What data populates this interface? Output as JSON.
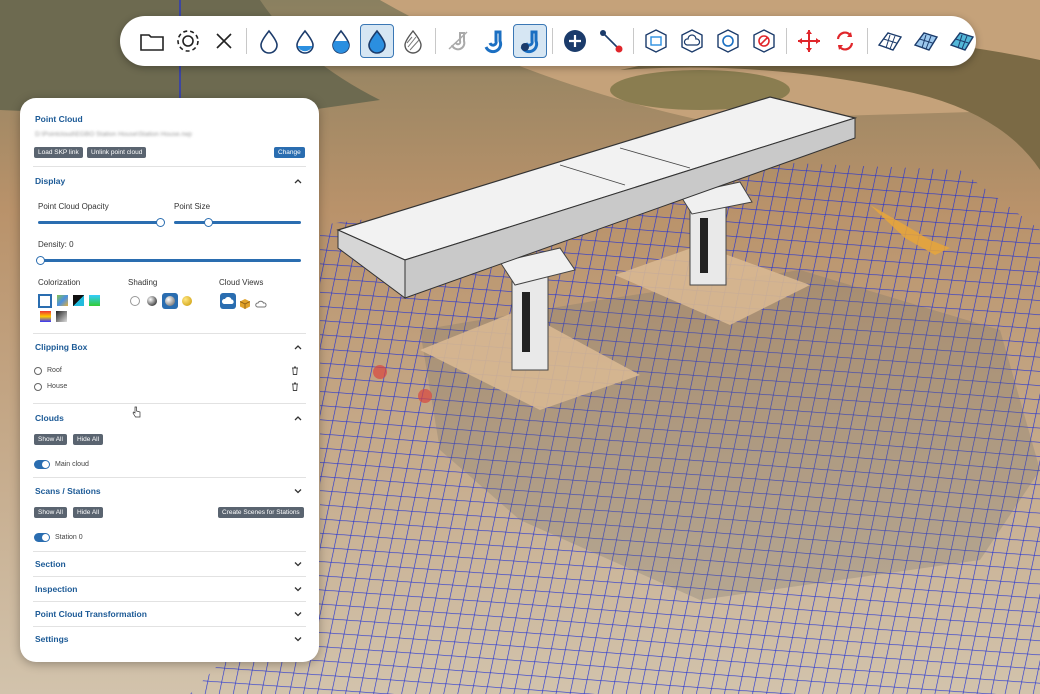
{
  "toolbar": {
    "icons": [
      "folder-icon",
      "gear-icon",
      "close-icon",
      "drop-outline-icon",
      "drop-half-icon",
      "drop-fill-icon",
      "drop-solid-icon",
      "drop-hatched-icon",
      "magnet-off-icon",
      "magnet-icon",
      "magnet-active-icon",
      "add-point-icon",
      "measure-line-icon",
      "cube-plane-icon",
      "cube-cloud-icon",
      "cube-sphere-icon",
      "cube-forbidden-icon",
      "move-arrows-icon",
      "sync-icon",
      "mesh-icon",
      "mesh-shaded-icon",
      "mesh-color-icon"
    ]
  },
  "panel": {
    "title": "Point Cloud",
    "path": "D:\\Pointcloud\\EGBO Station House\\Station House.rwp",
    "load_skp": "Load SKP link",
    "unlink": "Unlink point cloud",
    "change": "Change",
    "display": {
      "title": "Display",
      "opacity_label": "Point Cloud Opacity",
      "opacity_value": 1.0,
      "size_label": "Point Size",
      "size_value": 0.27,
      "density_label": "Density: 0",
      "density_value": 0,
      "colorization": "Colorization",
      "shading": "Shading",
      "cloud_views": "Cloud Views"
    },
    "clipping": {
      "title": "Clipping Box",
      "items": [
        "Roof",
        "House"
      ]
    },
    "clouds": {
      "title": "Clouds",
      "show_all": "Show All",
      "hide_all": "Hide All",
      "item": "Main cloud"
    },
    "scans": {
      "title": "Scans / Stations",
      "show_all": "Show All",
      "hide_all": "Hide All",
      "create": "Create Scenes for Stations",
      "item": "Station 0"
    },
    "collapsed": [
      "Section",
      "Inspection",
      "Point Cloud Transformation",
      "Settings"
    ]
  },
  "colors": {
    "accent": "#2a6db0",
    "title": "#1c5a96",
    "mesh": "#1d2ed6"
  }
}
